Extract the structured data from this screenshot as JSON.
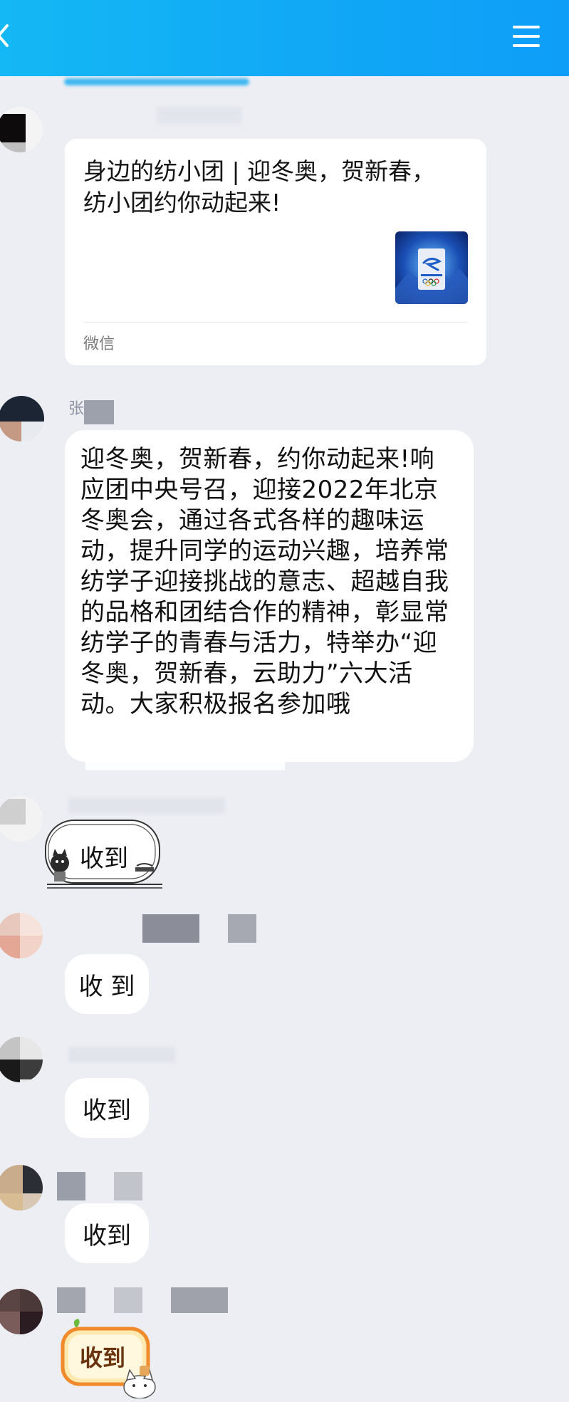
{
  "header": {
    "title": "",
    "back_icon": "chevron-left-icon",
    "menu_icon": "hamburger-menu-icon",
    "colors": {
      "bar_start": "#14b8f4",
      "bar_end": "#0e9ef8"
    }
  },
  "messages": [
    {
      "type": "link_card",
      "title": "身边的纺小团 | 迎冬奥，贺新春，纺小团约你动起来!",
      "thumbnail_icon": "beijing-2022-olympic-emblem-icon",
      "source": "微信"
    },
    {
      "type": "text",
      "sender": "张",
      "text": "迎冬奥，贺新春，约你动起来!响应团中央号召，迎接2022年北京冬奥会，通过各式各样的趣味运动，提升同学的运动兴趣，培养常纺学子迎接挑战的意志、超越自我的品格和团结合作的精神，彰显常纺学子的青春与活力，特举办“迎冬奥，贺新春，云助力”六大活动。大家积极报名参加哦"
    },
    {
      "type": "sticker",
      "text": "收到",
      "style": "ink-cat-frame-sticker"
    },
    {
      "type": "text",
      "text": "收 到"
    },
    {
      "type": "text",
      "text": "收到"
    },
    {
      "type": "text",
      "text": "收到"
    },
    {
      "type": "sticker",
      "text": "收到",
      "style": "orange-frame-cat-sticker"
    }
  ]
}
